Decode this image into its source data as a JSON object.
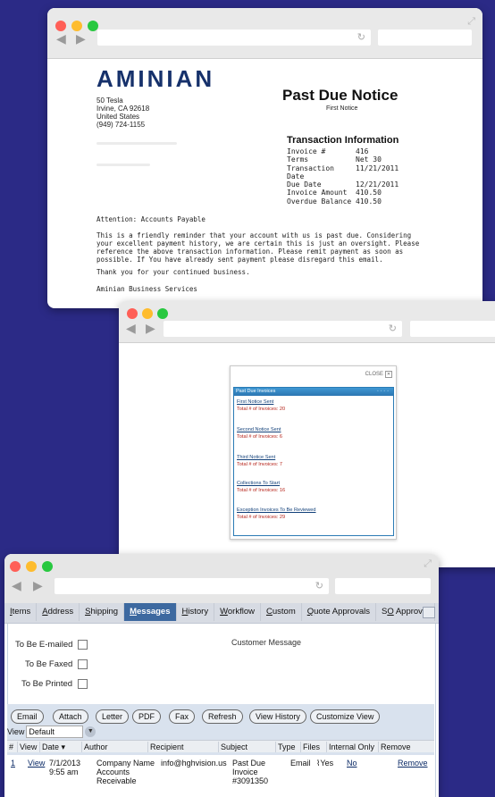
{
  "invoice_window": {
    "logo_text": "AMINIAN",
    "address": [
      "50 Tesla",
      "Irvine, CA 92618",
      "United States",
      "(949) 724-1155"
    ],
    "notice_title": "Past Due Notice",
    "notice_subtitle": "First Notice",
    "transaction_title": "Transaction Information",
    "transaction_rows": [
      {
        "label": "Invoice #",
        "value": "416"
      },
      {
        "label": "Terms",
        "value": "Net 30"
      },
      {
        "label": "Transaction Date",
        "value": "11/21/2011"
      },
      {
        "label": "Due Date",
        "value": "12/21/2011"
      },
      {
        "label": "Invoice Amount",
        "value": "410.50"
      },
      {
        "label": "Overdue Balance",
        "value": "410.50"
      }
    ],
    "attention": "Attention: Accounts Payable",
    "paragraph": "This is a friendly reminder that your account with us is past due. Considering your excellent payment history, we are certain this is just an oversight. Please reference the above transaction information. Please remit payment as soon as possible. If You have already sent payment please disregard this email.",
    "thanks": "Thank you for your continued business.",
    "signature": "Aminian Business Services"
  },
  "dashboard_window": {
    "close_label": "CLOSE",
    "panel_title": "Past Due Invoices",
    "items": [
      {
        "link": "First Notice Sent",
        "total": "Total # of Invoices: 20"
      },
      {
        "link": "Second Notice Sent",
        "total": "Total # of Invoices: 6"
      },
      {
        "link": "Third Notice Sent",
        "total": "Total # of Invoices: 7"
      },
      {
        "link": "Collections To Start",
        "total": "Total # of Invoices: 16"
      },
      {
        "link": "Exception Invoices To Be Reviewed",
        "total": "Total # of Invoices: 29"
      }
    ]
  },
  "messages_window": {
    "tabs": [
      {
        "u": "I",
        "rest": "tems"
      },
      {
        "u": "A",
        "rest": "ddress"
      },
      {
        "u": "S",
        "rest": "hipping"
      },
      {
        "u": "M",
        "rest": "essages"
      },
      {
        "u": "H",
        "rest": "istory"
      },
      {
        "u": "W",
        "rest": "orkflow"
      },
      {
        "u": "C",
        "rest": "ustom"
      },
      {
        "u": "Q",
        "rest": "uote Approvals"
      },
      {
        "pre": "S",
        "u": "O",
        "rest": " Approval"
      }
    ],
    "active_tab": "Messages",
    "checkboxes": [
      "To Be E-mailed",
      "To Be Faxed",
      "To Be Printed"
    ],
    "customer_message_label": "Customer Message",
    "buttons": [
      "Email",
      "Attach",
      "Letter",
      "PDF",
      "Fax",
      "Refresh",
      "View History",
      "Customize View"
    ],
    "view_label": "View",
    "view_value": "Default",
    "columns": [
      "#",
      "View",
      "Date ▾",
      "Author",
      "Recipient",
      "Subject",
      "Type",
      "Files",
      "Internal Only",
      "Remove"
    ],
    "rows": [
      {
        "num": "1",
        "view": "View",
        "date": [
          "7/1/2013",
          "9:55 am"
        ],
        "author": [
          "Company Name",
          "Accounts",
          "Receivable"
        ],
        "recipient": "info@hghvision.us",
        "subject": [
          "Past Due",
          "Invoice",
          "#3091350"
        ],
        "type": "Email",
        "files": "Yes",
        "internal_only": "No",
        "remove": "Remove"
      }
    ]
  }
}
